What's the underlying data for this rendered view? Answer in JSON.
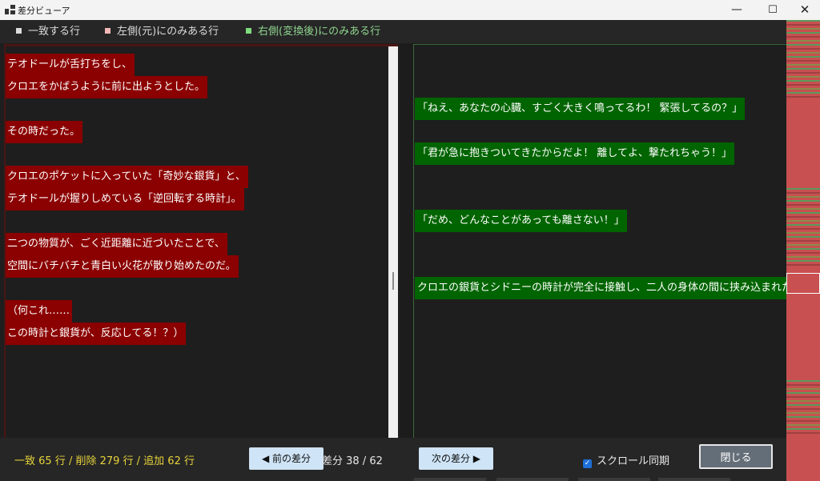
{
  "window": {
    "title": "差分ビューア",
    "min_glyph": "—",
    "max_glyph": "☐",
    "close_glyph": "✕"
  },
  "legend": {
    "same": {
      "label": "一致する行",
      "color": "#dcdcdc"
    },
    "left_only": {
      "label": "左側(元)にのみある行",
      "color": "#f2b8b8"
    },
    "right_only": {
      "label": "右側(変換後)にのみある行",
      "color": "#7fdc7f"
    }
  },
  "left_pane": {
    "lines": [
      {
        "text": "テオドールが舌打ちをし、",
        "kind": "del"
      },
      {
        "text": "クロエをかばうように前に出ようとした。",
        "kind": "del"
      },
      {
        "text": "",
        "kind": "blank"
      },
      {
        "text": "その時だった。",
        "kind": "del"
      },
      {
        "text": "",
        "kind": "blank"
      },
      {
        "text": "クロエのポケットに入っていた「奇妙な銀貨」と、",
        "kind": "del"
      },
      {
        "text": "テオドールが握りしめている「逆回転する時計」。",
        "kind": "del"
      },
      {
        "text": "",
        "kind": "blank"
      },
      {
        "text": "二つの物質が、ごく近距離に近づいたことで、",
        "kind": "del"
      },
      {
        "text": "空間にバチバチと青白い火花が散り始めたのだ。",
        "kind": "del"
      },
      {
        "text": "",
        "kind": "blank"
      },
      {
        "text": "（何これ……",
        "kind": "del"
      },
      {
        "text": "この時計と銀貨が、反応してる！？）",
        "kind": "del"
      }
    ]
  },
  "right_pane": {
    "lines": [
      {
        "text": "",
        "kind": "blank"
      },
      {
        "text": "",
        "kind": "blank"
      },
      {
        "text": "「ねえ、あなたの心臓、すごく大きく鳴ってるわ！ 緊張してるの？」",
        "kind": "add"
      },
      {
        "text": "",
        "kind": "blank"
      },
      {
        "text": "「君が急に抱きついてきたからだよ！ 離してよ、撃たれちゃう！」",
        "kind": "add"
      },
      {
        "text": "",
        "kind": "blank"
      },
      {
        "text": "",
        "kind": "blank"
      },
      {
        "text": "「だめ、どんなことがあっても離さない！」",
        "kind": "add"
      },
      {
        "text": "",
        "kind": "blank"
      },
      {
        "text": "",
        "kind": "blank"
      },
      {
        "text": "クロエの銀貨とシドニーの時計が完全に接触し、二人の身体の間に挟み込まれた",
        "kind": "add"
      }
    ]
  },
  "footer": {
    "stats": "一致 65 行 / 削除 279 行 / 追加 62 行",
    "prev_button": "◀ 前の差分",
    "diff_counter": "差分 38 / 62",
    "next_button": "次の差分 ▶",
    "scroll_sync_label": "スクロール同期",
    "scroll_sync_checked": true,
    "close_button": "閉じる"
  },
  "colors": {
    "deleted_bg": "#8b0000",
    "added_bg": "#006400",
    "stats_text": "#e8d43c",
    "minimap_deleted": "#c85050",
    "minimap_added": "#5a9a5a"
  }
}
